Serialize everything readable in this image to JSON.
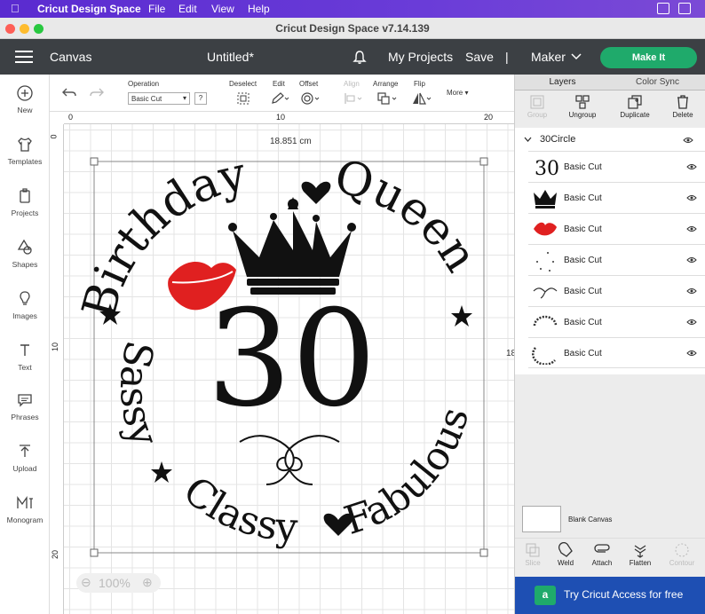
{
  "macbar": {
    "app_name": "Cricut Design Space",
    "menus": [
      "File",
      "Edit",
      "View",
      "Help"
    ]
  },
  "window": {
    "title": "Cricut Design Space  v7.14.139"
  },
  "header": {
    "canvas_label": "Canvas",
    "doc_title": "Untitled*",
    "my_projects": "My Projects",
    "save": "Save",
    "separator": "|",
    "machine": "Maker",
    "make_it": "Make It"
  },
  "leftnav": [
    "New",
    "Templates",
    "Projects",
    "Shapes",
    "Images",
    "Text",
    "Phrases",
    "Upload",
    "Monogram"
  ],
  "toolbar": {
    "operation_label": "Operation",
    "operation_value": "Basic Cut",
    "help": "?",
    "deselect": "Deselect",
    "edit": "Edit",
    "offset": "Offset",
    "align": "Align",
    "arrange": "Arrange",
    "flip": "Flip",
    "more": "More ▾"
  },
  "ruler": {
    "h_ticks": [
      "0",
      "10",
      "20"
    ],
    "v_ticks": [
      "0",
      "10",
      "20"
    ]
  },
  "canvas": {
    "width_label": "18.851 cm",
    "height_label": "18",
    "zoom": "100%",
    "design": {
      "top_left": "Birthday",
      "top_right": "Queen",
      "number": "30",
      "left": "Sassy",
      "bottom": "Classy",
      "right": "Fabulous"
    }
  },
  "panel": {
    "tabs": [
      "Layers",
      "Color Sync"
    ],
    "tools": [
      "Group",
      "Ungroup",
      "Duplicate",
      "Delete"
    ],
    "group_name": "30Circle",
    "layers": [
      "Basic Cut",
      "Basic Cut",
      "Basic Cut",
      "Basic Cut",
      "Basic Cut",
      "Basic Cut",
      "Basic Cut"
    ],
    "layer_thumb_text": "30",
    "blank_canvas": "Blank Canvas",
    "bottom_tools": [
      "Slice",
      "Weld",
      "Attach",
      "Flatten",
      "Contour"
    ],
    "access": "Try Cricut Access for free",
    "access_badge": "a"
  },
  "colors": {
    "header_bg": "#3c4044",
    "make_it_green": "#1faa6b",
    "access_blue": "#1e4fb3",
    "lips_red": "#e02020",
    "mac_purple": "#5a2bd0"
  }
}
